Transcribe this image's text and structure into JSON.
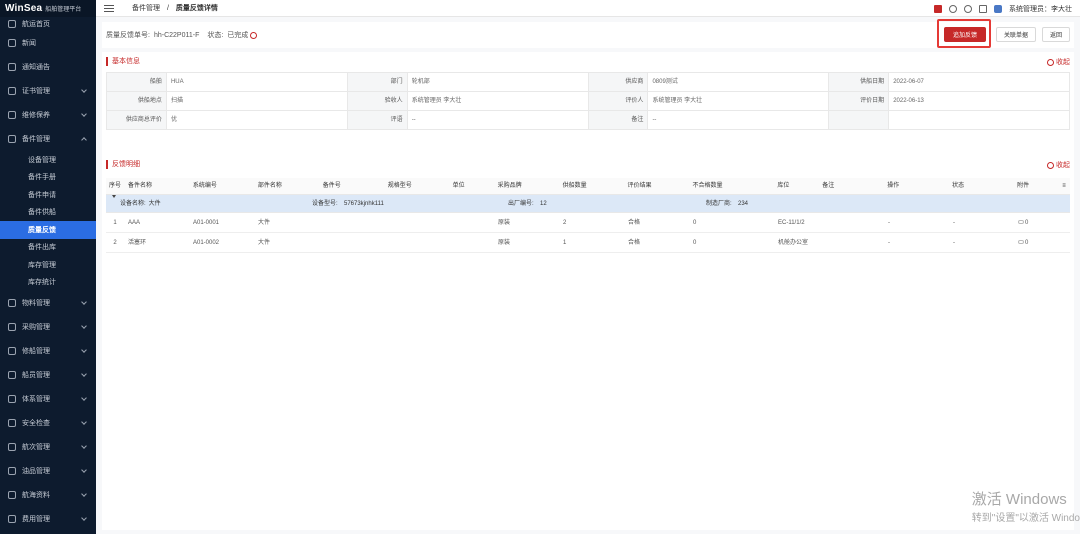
{
  "brand": {
    "name": "WinSea",
    "subtitle": "船舶管理平台"
  },
  "sidebar": {
    "items": [
      {
        "label": "航运首页",
        "icon": "home-icon"
      },
      {
        "label": "新闻",
        "icon": "news-icon"
      },
      {
        "label": "通知通告",
        "icon": "notice-icon"
      },
      {
        "label": "证书管理",
        "icon": "certificate-icon"
      },
      {
        "label": "维修保养",
        "icon": "wrench-icon"
      },
      {
        "label": "备件管理",
        "icon": "parts-icon"
      }
    ],
    "subitems": [
      "设备管理",
      "备件手册",
      "备件申请",
      "备件供船",
      "质量反馈",
      "备件出库",
      "库存管理",
      "库存统计"
    ],
    "items_after": [
      {
        "label": "物料管理",
        "icon": "material-icon"
      },
      {
        "label": "采购管理",
        "icon": "cart-icon"
      },
      {
        "label": "修船管理",
        "icon": "repair-icon"
      },
      {
        "label": "船员管理",
        "icon": "crew-icon"
      },
      {
        "label": "体系管理",
        "icon": "system-icon"
      },
      {
        "label": "安全检查",
        "icon": "shield-icon"
      },
      {
        "label": "航次管理",
        "icon": "voyage-icon"
      },
      {
        "label": "油品管理",
        "icon": "oil-icon"
      },
      {
        "label": "航海资料",
        "icon": "book-icon"
      },
      {
        "label": "费用管理",
        "icon": "cost-icon"
      }
    ]
  },
  "topbar": {
    "breadcrumb_parent": "备件管理",
    "breadcrumb_separator": "/",
    "breadcrumb_current": "质量反馈详情",
    "user": "系统管理员：李大壮"
  },
  "header": {
    "order_label": "质量反馈单号:",
    "order_no": "hh-C22P011-F",
    "status_label": "状态:",
    "status": "已完成",
    "buttons": {
      "add_feedback": "追加反馈",
      "related_order": "关联单据",
      "back": "返回"
    }
  },
  "basic_info": {
    "title": "基本信息",
    "collapse": "收起",
    "rows": [
      [
        [
          "船舶",
          "HUA"
        ],
        [
          "部门",
          "轮机部"
        ],
        [
          "供应商",
          "0809测试"
        ],
        [
          "供船日期",
          "2022-06-07"
        ]
      ],
      [
        [
          "供船地点",
          "扫描"
        ],
        [
          "验收人",
          "系统管理员 李大壮"
        ],
        [
          "评价人",
          "系统管理员 李大壮"
        ],
        [
          "评价日期",
          "2022-06-13"
        ]
      ],
      [
        [
          "供应商总评价",
          "优"
        ],
        [
          "评语",
          "--"
        ],
        [
          "备注",
          "--"
        ],
        [
          "",
          ""
        ]
      ]
    ]
  },
  "feedback": {
    "title": "反馈明细",
    "collapse": "收起",
    "columns": [
      "序号",
      "备件名称",
      "系统编号",
      "部件名称",
      "备件号",
      "规格型号",
      "单位",
      "采购品牌",
      "供船数量",
      "评价结果",
      "不合格数量",
      "库位",
      "备注",
      "操作",
      "状态",
      "附件"
    ],
    "group": {
      "name_label": "设备名称:",
      "name": "大件",
      "model_label": "设备型号:",
      "model": "57673kjnhk111",
      "serial_label": "出厂编号:",
      "serial": "12",
      "maker_label": "制造厂商:",
      "maker": "234"
    },
    "rows": [
      [
        "1",
        "AAA",
        "A01-0001",
        "大件",
        "",
        "",
        "",
        "原装",
        "2",
        "合格",
        "0",
        "EC-11/1/2",
        "",
        "-",
        "-",
        "0"
      ],
      [
        "2",
        "活塞环",
        "A01-0002",
        "大件",
        "",
        "",
        "",
        "原装",
        "1",
        "合格",
        "0",
        "机舱办公室",
        "",
        "-",
        "-",
        "0"
      ]
    ]
  },
  "watermark": {
    "line1": "激活 Windows",
    "line2": "转到\"设置\"以激活 Windo"
  },
  "colors": {
    "accent": "#c62828",
    "sidebar": "#0d1b2e",
    "active": "#2b6de3"
  }
}
